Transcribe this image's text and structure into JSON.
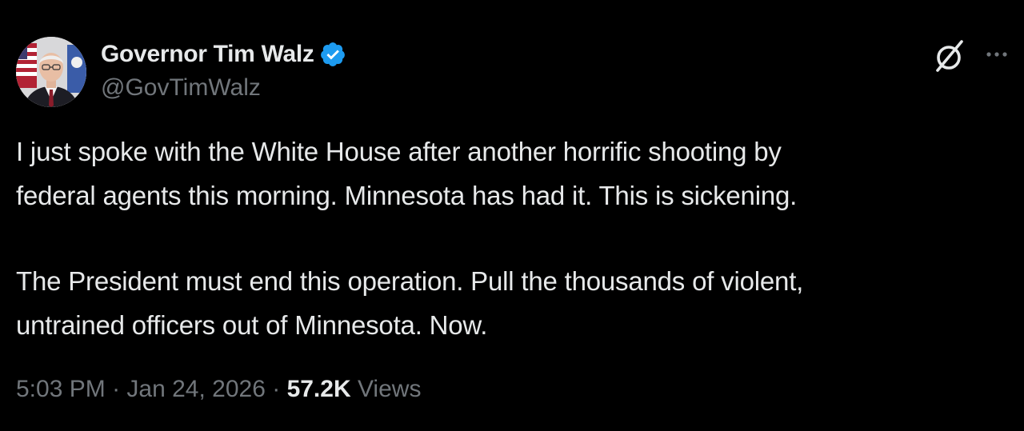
{
  "author": {
    "display_name": "Governor Tim Walz",
    "handle": "@GovTimWalz",
    "verified": true,
    "verified_color": "#1d9bf0"
  },
  "actions": {
    "grok_icon": "grok-icon",
    "more_icon": "more-icon"
  },
  "tweet": {
    "paragraph1_line1": "I just spoke with the White House after another horrific shooting by",
    "paragraph1_line2": "federal agents this morning. Minnesota has had it. This is sickening.",
    "paragraph2_line1": "The President must end this operation. Pull the thousands of violent,",
    "paragraph2_line2": "untrained officers out of Minnesota. Now."
  },
  "meta": {
    "time": "5:03 PM",
    "separator": " · ",
    "date": "Jan 24, 2026",
    "views_count": "57.2K",
    "views_label": "Views"
  },
  "colors": {
    "background": "#000000",
    "primary_text": "#e7e9ea",
    "secondary_text": "#71767b"
  }
}
